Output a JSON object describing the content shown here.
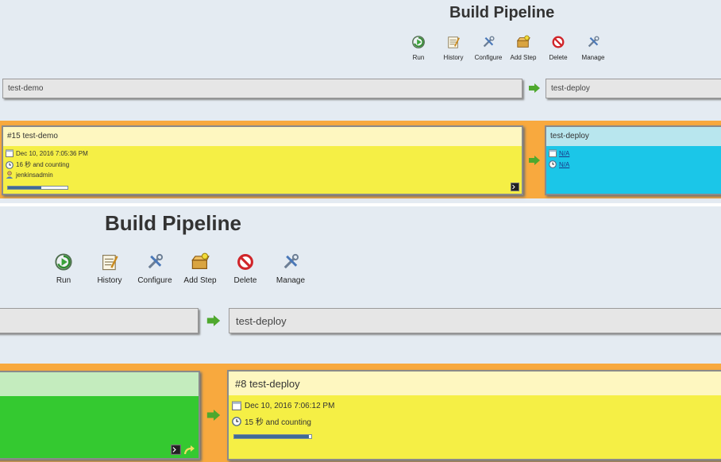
{
  "top": {
    "title": "Build Pipeline",
    "toolbar": {
      "run": "Run",
      "history": "History",
      "configure": "Configure",
      "add_step": "Add Step",
      "delete": "Delete",
      "manage": "Manage"
    },
    "headers": [
      "test-demo",
      "test-deploy"
    ],
    "build_card": {
      "title": "#15 test-demo",
      "date": "Dec 10, 2016 7:05:36 PM",
      "duration": "16 秒 and counting",
      "user": "jenkinsadmin",
      "progress": 0.56
    },
    "pending_card": {
      "title": "test-deploy",
      "date": "N/A",
      "duration": "N/A"
    }
  },
  "bottom": {
    "title": "Build Pipeline",
    "toolbar": {
      "run": "Run",
      "history": "History",
      "configure": "Configure",
      "add_step": "Add Step",
      "delete": "Delete",
      "manage": "Manage"
    },
    "headers": [
      "test-deploy"
    ],
    "build_card": {
      "title": "#8 test-deploy",
      "date": "Dec 10, 2016 7:06:12 PM",
      "duration": "15 秒 and counting",
      "progress": 0.97
    }
  },
  "colors": {
    "page_bg": "#e4ebf2",
    "band": "#f8a93e",
    "running": "#f5ef45",
    "running_head": "#fef7c0",
    "pending": "#1bc6e8",
    "pending_head": "#b8e6ee",
    "success": "#34c930",
    "success_head": "#c4ecbe",
    "progress_fill": "#3f6a96"
  },
  "icons": [
    "run-icon",
    "history-icon",
    "configure-icon",
    "add-step-icon",
    "delete-icon",
    "manage-icon",
    "calendar-icon",
    "clock-icon",
    "user-icon",
    "console-icon",
    "next-arrow-icon"
  ]
}
